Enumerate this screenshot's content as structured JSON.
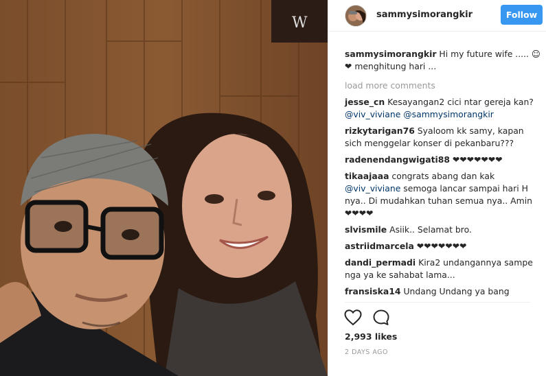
{
  "post": {
    "username": "sammysimorangkir",
    "follow_label": "Follow",
    "caption": {
      "user": "sammysimorangkir",
      "text": "Hi my future wife ..... ☺ ❤ menghitung hari ..."
    },
    "load_more_label": "load more comments",
    "comments": [
      {
        "user": "jesse_cn",
        "parts": [
          {
            "t": "text",
            "v": "Kesayangan2 cici ntar gereja kan? "
          },
          {
            "t": "mention",
            "v": "@viv_viviane"
          },
          {
            "t": "text",
            "v": " "
          },
          {
            "t": "mention",
            "v": "@sammysimorangkir"
          }
        ]
      },
      {
        "user": "rizkytarigan76",
        "parts": [
          {
            "t": "text",
            "v": "Syaloom kk samy, kapan sich menggelar konser di pekanbaru???"
          }
        ]
      },
      {
        "user": "radenendangwigati88",
        "parts": [
          {
            "t": "text",
            "v": "❤❤❤❤❤❤❤"
          }
        ]
      },
      {
        "user": "tikaajaaa",
        "parts": [
          {
            "t": "text",
            "v": "congrats abang dan kak "
          },
          {
            "t": "mention",
            "v": "@viv_viviane"
          },
          {
            "t": "text",
            "v": " semoga lancar sampai hari H nya.. Di mudahkan tuhan semua nya.. Amin ❤❤❤❤"
          }
        ]
      },
      {
        "user": "slvismile",
        "parts": [
          {
            "t": "text",
            "v": "Asiik.. Selamat bro."
          }
        ]
      },
      {
        "user": "astriidmarcela",
        "parts": [
          {
            "t": "text",
            "v": "❤❤❤❤❤❤❤"
          }
        ]
      },
      {
        "user": "dandi_permadi",
        "parts": [
          {
            "t": "text",
            "v": "Kira2 undangannya sampe nga ya ke sahabat lama..."
          }
        ]
      },
      {
        "user": "fransiska14",
        "parts": [
          {
            "t": "text",
            "v": "Undang Undang ya bang"
          }
        ]
      }
    ],
    "likes": "2,993 likes",
    "timestamp": "2 DAYS AGO",
    "icons": {
      "like": "heart-outline-icon",
      "comment": "speech-bubble-icon"
    },
    "colors": {
      "follow_button": "#3897f0",
      "mention": "#003569",
      "muted": "#999999"
    }
  }
}
